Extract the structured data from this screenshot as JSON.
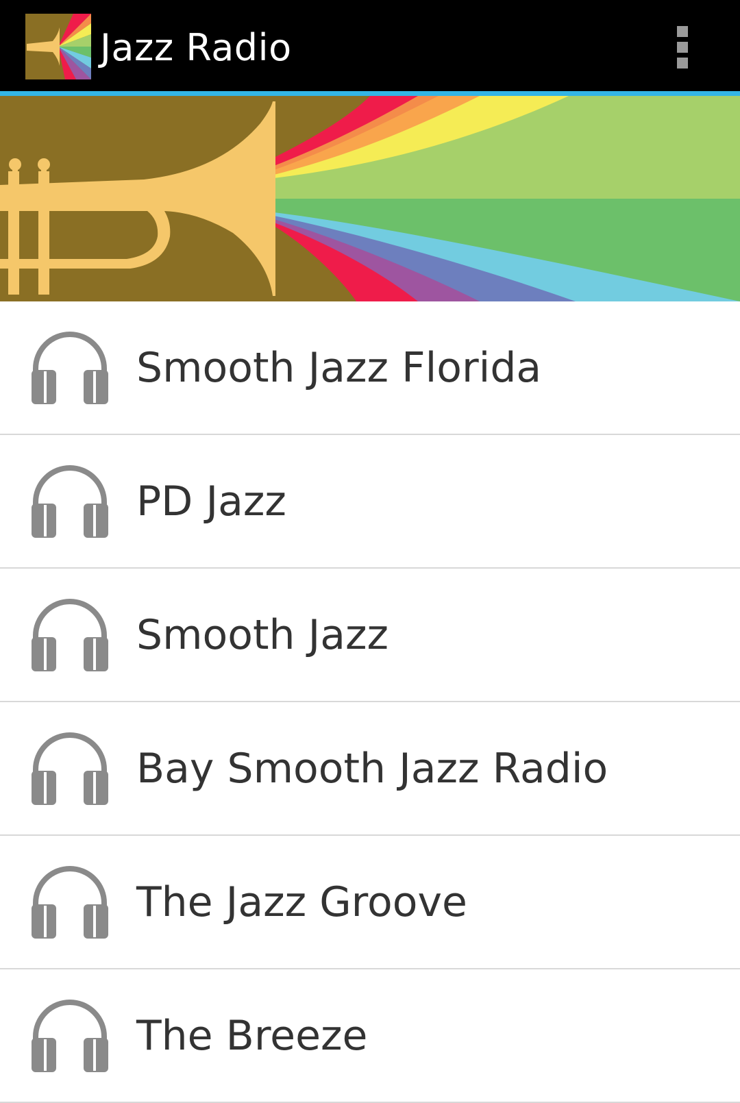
{
  "action_bar": {
    "title": "Jazz Radio",
    "icon": "jazz-radio-app-icon",
    "overflow_icon": "overflow-menu-icon",
    "accent_color": "#33b5e5"
  },
  "banner": {
    "icon": "trumpet-rainbow-banner",
    "colors": [
      "#8a6f24",
      "#f5c76a",
      "#ef1c4a",
      "#f48c4a",
      "#f9a54c",
      "#f5ec55",
      "#a6d06a",
      "#6cc06a",
      "#72cce0",
      "#6d7fbe",
      "#9e55a0"
    ]
  },
  "stations": [
    {
      "label": "Smooth Jazz Florida",
      "icon": "headphones-icon"
    },
    {
      "label": "PD Jazz",
      "icon": "headphones-icon"
    },
    {
      "label": "Smooth Jazz",
      "icon": "headphones-icon"
    },
    {
      "label": "Bay Smooth Jazz Radio",
      "icon": "headphones-icon"
    },
    {
      "label": "The Jazz Groove",
      "icon": "headphones-icon"
    },
    {
      "label": "The Breeze",
      "icon": "headphones-icon"
    }
  ]
}
